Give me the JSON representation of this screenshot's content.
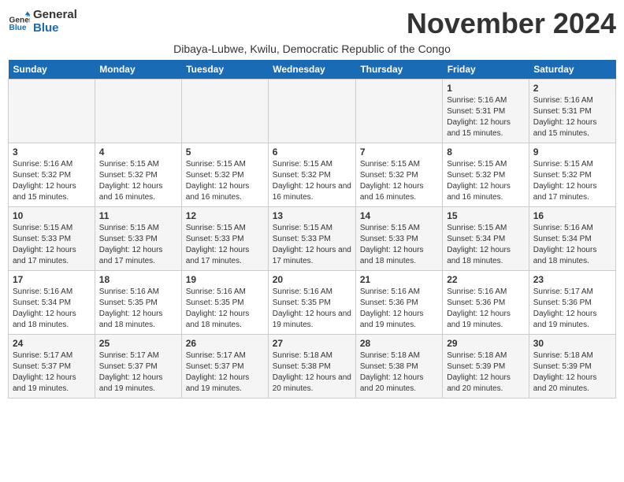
{
  "logo": {
    "line1": "General",
    "line2": "Blue"
  },
  "title": "November 2024",
  "subtitle": "Dibaya-Lubwe, Kwilu, Democratic Republic of the Congo",
  "weekdays": [
    "Sunday",
    "Monday",
    "Tuesday",
    "Wednesday",
    "Thursday",
    "Friday",
    "Saturday"
  ],
  "weeks": [
    [
      {
        "day": "",
        "detail": ""
      },
      {
        "day": "",
        "detail": ""
      },
      {
        "day": "",
        "detail": ""
      },
      {
        "day": "",
        "detail": ""
      },
      {
        "day": "",
        "detail": ""
      },
      {
        "day": "1",
        "detail": "Sunrise: 5:16 AM\nSunset: 5:31 PM\nDaylight: 12 hours and 15 minutes."
      },
      {
        "day": "2",
        "detail": "Sunrise: 5:16 AM\nSunset: 5:31 PM\nDaylight: 12 hours and 15 minutes."
      }
    ],
    [
      {
        "day": "3",
        "detail": "Sunrise: 5:16 AM\nSunset: 5:32 PM\nDaylight: 12 hours and 15 minutes."
      },
      {
        "day": "4",
        "detail": "Sunrise: 5:15 AM\nSunset: 5:32 PM\nDaylight: 12 hours and 16 minutes."
      },
      {
        "day": "5",
        "detail": "Sunrise: 5:15 AM\nSunset: 5:32 PM\nDaylight: 12 hours and 16 minutes."
      },
      {
        "day": "6",
        "detail": "Sunrise: 5:15 AM\nSunset: 5:32 PM\nDaylight: 12 hours and 16 minutes."
      },
      {
        "day": "7",
        "detail": "Sunrise: 5:15 AM\nSunset: 5:32 PM\nDaylight: 12 hours and 16 minutes."
      },
      {
        "day": "8",
        "detail": "Sunrise: 5:15 AM\nSunset: 5:32 PM\nDaylight: 12 hours and 16 minutes."
      },
      {
        "day": "9",
        "detail": "Sunrise: 5:15 AM\nSunset: 5:32 PM\nDaylight: 12 hours and 17 minutes."
      }
    ],
    [
      {
        "day": "10",
        "detail": "Sunrise: 5:15 AM\nSunset: 5:33 PM\nDaylight: 12 hours and 17 minutes."
      },
      {
        "day": "11",
        "detail": "Sunrise: 5:15 AM\nSunset: 5:33 PM\nDaylight: 12 hours and 17 minutes."
      },
      {
        "day": "12",
        "detail": "Sunrise: 5:15 AM\nSunset: 5:33 PM\nDaylight: 12 hours and 17 minutes."
      },
      {
        "day": "13",
        "detail": "Sunrise: 5:15 AM\nSunset: 5:33 PM\nDaylight: 12 hours and 17 minutes."
      },
      {
        "day": "14",
        "detail": "Sunrise: 5:15 AM\nSunset: 5:33 PM\nDaylight: 12 hours and 18 minutes."
      },
      {
        "day": "15",
        "detail": "Sunrise: 5:15 AM\nSunset: 5:34 PM\nDaylight: 12 hours and 18 minutes."
      },
      {
        "day": "16",
        "detail": "Sunrise: 5:16 AM\nSunset: 5:34 PM\nDaylight: 12 hours and 18 minutes."
      }
    ],
    [
      {
        "day": "17",
        "detail": "Sunrise: 5:16 AM\nSunset: 5:34 PM\nDaylight: 12 hours and 18 minutes."
      },
      {
        "day": "18",
        "detail": "Sunrise: 5:16 AM\nSunset: 5:35 PM\nDaylight: 12 hours and 18 minutes."
      },
      {
        "day": "19",
        "detail": "Sunrise: 5:16 AM\nSunset: 5:35 PM\nDaylight: 12 hours and 18 minutes."
      },
      {
        "day": "20",
        "detail": "Sunrise: 5:16 AM\nSunset: 5:35 PM\nDaylight: 12 hours and 19 minutes."
      },
      {
        "day": "21",
        "detail": "Sunrise: 5:16 AM\nSunset: 5:36 PM\nDaylight: 12 hours and 19 minutes."
      },
      {
        "day": "22",
        "detail": "Sunrise: 5:16 AM\nSunset: 5:36 PM\nDaylight: 12 hours and 19 minutes."
      },
      {
        "day": "23",
        "detail": "Sunrise: 5:17 AM\nSunset: 5:36 PM\nDaylight: 12 hours and 19 minutes."
      }
    ],
    [
      {
        "day": "24",
        "detail": "Sunrise: 5:17 AM\nSunset: 5:37 PM\nDaylight: 12 hours and 19 minutes."
      },
      {
        "day": "25",
        "detail": "Sunrise: 5:17 AM\nSunset: 5:37 PM\nDaylight: 12 hours and 19 minutes."
      },
      {
        "day": "26",
        "detail": "Sunrise: 5:17 AM\nSunset: 5:37 PM\nDaylight: 12 hours and 19 minutes."
      },
      {
        "day": "27",
        "detail": "Sunrise: 5:18 AM\nSunset: 5:38 PM\nDaylight: 12 hours and 20 minutes."
      },
      {
        "day": "28",
        "detail": "Sunrise: 5:18 AM\nSunset: 5:38 PM\nDaylight: 12 hours and 20 minutes."
      },
      {
        "day": "29",
        "detail": "Sunrise: 5:18 AM\nSunset: 5:39 PM\nDaylight: 12 hours and 20 minutes."
      },
      {
        "day": "30",
        "detail": "Sunrise: 5:18 AM\nSunset: 5:39 PM\nDaylight: 12 hours and 20 minutes."
      }
    ]
  ]
}
